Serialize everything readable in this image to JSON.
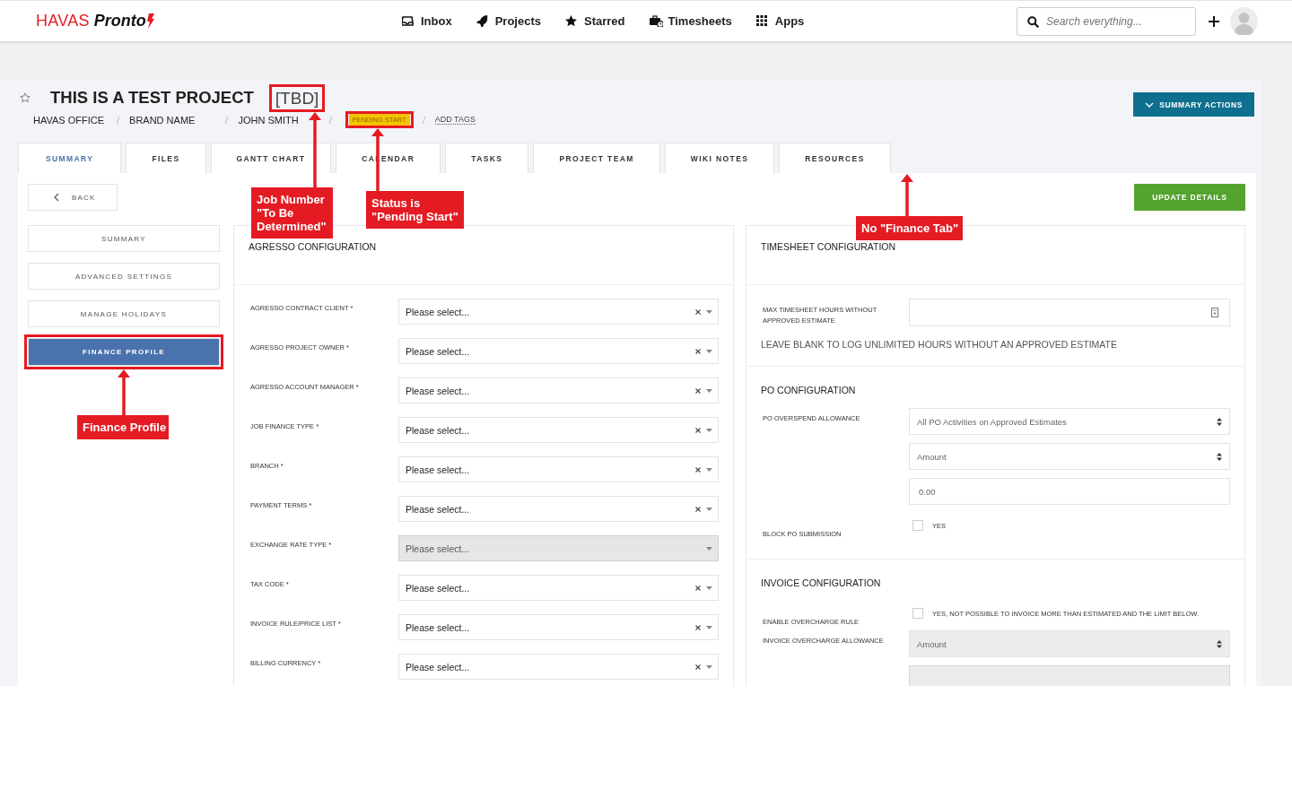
{
  "header": {
    "brand": "HAVAS",
    "product": "Pronto",
    "nav": [
      {
        "label": "Inbox",
        "kind": "inbox"
      },
      {
        "label": "Projects",
        "kind": "projects"
      },
      {
        "label": "Starred",
        "kind": "starred"
      },
      {
        "label": "Timesheets",
        "kind": "timesheets"
      },
      {
        "label": "Apps",
        "kind": "apps"
      }
    ],
    "search": {
      "placeholder": "Search everything..."
    }
  },
  "project": {
    "title": "THIS IS A TEST PROJECT",
    "job_number": "[TBD]",
    "breadcrumbs": [
      "HAVAS OFFICE",
      "BRAND NAME",
      "JOHN SMITH"
    ],
    "status": "PENDING START",
    "add_tags": "ADD TAGS",
    "actions_button": "SUMMARY ACTIONS"
  },
  "tabs": [
    {
      "label": "SUMMARY",
      "selected": true
    },
    {
      "label": "FILES",
      "selected": false
    },
    {
      "label": "GANTT CHART",
      "selected": false
    },
    {
      "label": "CALENDAR",
      "selected": false
    },
    {
      "label": "TASKS",
      "selected": false
    },
    {
      "label": "PROJECT TEAM",
      "selected": false
    },
    {
      "label": "WIKI NOTES",
      "selected": false
    },
    {
      "label": "RESOURCES",
      "selected": false
    }
  ],
  "sidebar": {
    "back": "BACK",
    "items": [
      {
        "label": "SUMMARY",
        "selected": false
      },
      {
        "label": "ADVANCED SETTINGS",
        "selected": false
      },
      {
        "label": "MANAGE HOLIDAYS",
        "selected": false
      },
      {
        "label": "FINANCE PROFILE",
        "selected": true
      }
    ]
  },
  "update_button": "UPDATE DETAILS",
  "agresso": {
    "title": "AGRESSO CONFIGURATION",
    "fields": [
      {
        "label": "AGRESSO CONTRACT CLIENT *",
        "value": "Please select...",
        "disabled": false
      },
      {
        "label": "AGRESSO PROJECT OWNER *",
        "value": "Please select...",
        "disabled": false
      },
      {
        "label": "AGRESSO ACCOUNT MANAGER *",
        "value": "Please select...",
        "disabled": false
      },
      {
        "label": "JOB FINANCE TYPE *",
        "value": "Please select...",
        "disabled": false
      },
      {
        "label": "BRANCH *",
        "value": "Please select...",
        "disabled": false
      },
      {
        "label": "PAYMENT TERMS *",
        "value": "Please select...",
        "disabled": false
      },
      {
        "label": "EXCHANGE RATE TYPE *",
        "value": "Please select...",
        "disabled": true
      },
      {
        "label": "TAX CODE *",
        "value": "Please select...",
        "disabled": false
      },
      {
        "label": "INVOICE RULE/PRICE LIST *",
        "value": "Please select...",
        "disabled": false
      },
      {
        "label": "BILLING CURRENCY *",
        "value": "Please select...",
        "disabled": false
      }
    ]
  },
  "config": {
    "title": "TIMESHEET CONFIGURATION",
    "sections": [
      {
        "items": [
          {
            "kind": "number",
            "label": "MAX TIMESHEET HOURS WITHOUT APPROVED ESTIMATE"
          },
          {
            "kind": "hint",
            "text": "LEAVE BLANK TO LOG UNLIMITED HOURS WITHOUT AN APPROVED ESTIMATE"
          }
        ]
      },
      {
        "title": "PO CONFIGURATION",
        "items": [
          {
            "kind": "select",
            "label": "PO OVERSPEND ALLOWANCE",
            "value": "All PO Activities on Approved Estimates",
            "disabled": false
          },
          {
            "kind": "select",
            "value": "Amount",
            "disabled": false
          },
          {
            "kind": "input",
            "value": "0.00",
            "disabled": false
          },
          {
            "kind": "checkbox",
            "label": "BLOCK PO SUBMISSION",
            "option": "YES",
            "checked": false
          }
        ]
      },
      {
        "title": "INVOICE CONFIGURATION",
        "items": [
          {
            "kind": "checkbox",
            "label": "ENABLE OVERCHARGE RULE",
            "option": "YES, NOT POSSIBLE TO INVOICE MORE THAN ESTIMATED AND THE LIMIT BELOW.",
            "checked": false
          },
          {
            "kind": "select",
            "label": "INVOICE OVERCHARGE ALLOWANCE",
            "value": "Amount",
            "disabled": true
          },
          {
            "kind": "input",
            "disabled": true
          }
        ]
      }
    ]
  },
  "annotations": [
    {
      "text": "Job Number \"To Be Determined\""
    },
    {
      "text": "Status is \"Pending Start\""
    },
    {
      "text": "No \"Finance Tab\""
    },
    {
      "text": "Finance Profile"
    }
  ]
}
